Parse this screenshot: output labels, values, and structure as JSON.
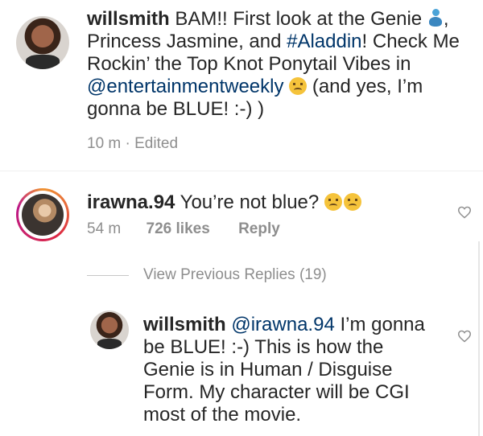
{
  "post": {
    "username": "willsmith",
    "caption_1": "BAM!! First look at the Genie",
    "caption_2": ", Princess Jasmine, and ",
    "hashtag": "#Aladdin",
    "caption_3": "! Check Me Rockin’ the Top Knot Ponytail Vibes in ",
    "mention": "@entertainmentweekly",
    "caption_4": " (and yes, I’m gonna be BLUE! :-) )",
    "time": "10 m",
    "edited": "· Edited"
  },
  "comment": {
    "username": "irawna.94",
    "text": "You’re not blue?",
    "time": "54 m",
    "likes": "726 likes",
    "reply": "Reply"
  },
  "replies": {
    "view_previous": "View Previous Replies (19)"
  },
  "reply1": {
    "username": "willsmith",
    "mention": "@irawna.94",
    "text": "I’m gonna be BLUE! :-) This is how the Genie is in Human / Disguise Form.  My character will be CGI most of the movie."
  },
  "icons": {
    "genie": "genie-emoji-icon",
    "grin": "grinning-squinting-emoji-icon",
    "worried": "worried-face-emoji-icon",
    "heart": "heart-outline-icon"
  }
}
